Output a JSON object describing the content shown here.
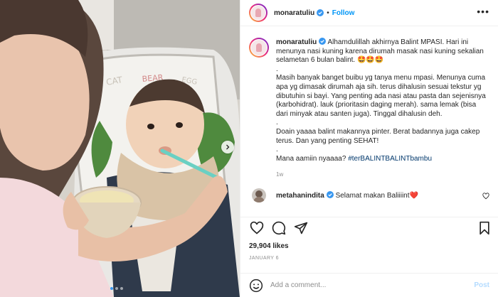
{
  "post": {
    "username": "monaratuliu",
    "follow_label": "Follow",
    "separator": "•",
    "more_label": "•••",
    "caption": {
      "username": "monaratuliu",
      "lines": [
        "Alhamdulillah akhirnya Balint MPASI. Hari ini menunya nasi kuning karena dirumah masak nasi kuning sekalian selametan 6 bulan balint. 🤩🤩🤩",
        ".",
        "Masih banyak banget buibu yg tanya menu mpasi. Menunya cuma apa yg dimasak dirumah aja sih. terus dihalusin sesuai tekstur yg dibutuhin si bayi. Yang penting ada nasi atau pasta dan sejenisnya (karbohidrat). lauk (prioritasin daging merah). sama lemak (bisa dari minyak atau santen juga). Tinggal dihalusin deh.",
        ".",
        "Doain yaaaa balint makannya pinter. Berat badannya juga cakep terus. Dan yang penting SEHAT!",
        "."
      ],
      "last_line_text": "Mana aamiin nyaaaa? ",
      "hashtag": "#terBALINTBALINTbambu",
      "time": "1w"
    },
    "comment": {
      "username": "metahanindita",
      "text": " Selamat makan Baliiiint❤️"
    },
    "likes": "29,904 likes",
    "date": "JANUARY 6",
    "add_comment_placeholder": "Add a comment...",
    "post_label": "Post",
    "carousel": {
      "count": 3,
      "active_index": 0
    }
  },
  "colors": {
    "verified_blue": "#3897f0",
    "follow_blue": "#0095f6",
    "hashtag": "#00376b",
    "muted": "#8e8e8e",
    "post_disabled": "#b3dbff"
  },
  "icons": [
    "verified-badge-icon",
    "more-options-icon",
    "heart-icon",
    "comment-icon",
    "share-icon",
    "save-icon",
    "emoji-icon",
    "chevron-right-icon"
  ]
}
